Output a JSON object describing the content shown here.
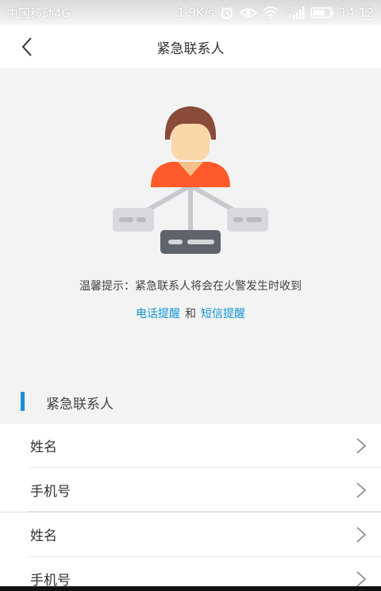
{
  "status_bar": {
    "carrier": "中国移动4G",
    "speed": "1.9K/s",
    "network": "4G",
    "time": "14:12"
  },
  "nav": {
    "title": "紧急联系人",
    "back_icon": "chevron-left-icon"
  },
  "illustration": {
    "icon": "contact-network-illustration",
    "colors": {
      "hair": "#8a4b3a",
      "face": "#f9d7a8",
      "shirt": "#ff5a2b",
      "node_light": "#d8d9dd",
      "node_dark": "#5f636b",
      "connector": "#c7c9cf"
    }
  },
  "hint": {
    "text": "温馨提示：紧急联系人将会在火警发生时收到",
    "link_phone": "电话提醒",
    "and": "和",
    "link_sms": "短信提醒",
    "link_color": "#1597d1"
  },
  "section": {
    "title": "紧急联系人",
    "accent_color": "#1a8fd8"
  },
  "contacts": [
    {
      "name_label": "姓名",
      "phone_label": "手机号"
    },
    {
      "name_label": "姓名",
      "phone_label": "手机号"
    }
  ]
}
